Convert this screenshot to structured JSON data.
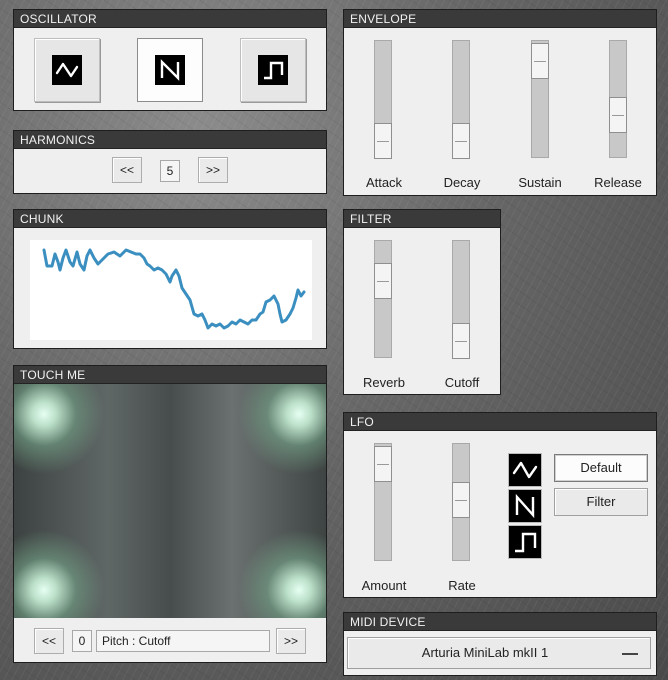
{
  "oscillator": {
    "title": "OSCILLATOR",
    "waveforms": [
      "sine-wave-icon",
      "sawtooth-wave-icon",
      "square-wave-icon"
    ],
    "selected_index": 1
  },
  "harmonics": {
    "title": "HARMONICS",
    "prev_label": "<<",
    "value": "5",
    "next_label": ">>"
  },
  "chunk": {
    "title": "CHUNK",
    "waveform_color": "#3a8fc0"
  },
  "touch": {
    "title": "TOUCH ME",
    "prev_label": "<<",
    "index": "0",
    "mapping": "Pitch :  Cutoff",
    "next_label": ">>",
    "glow_color": "#e6fff2"
  },
  "envelope": {
    "title": "ENVELOPE",
    "sliders": [
      {
        "label": "Attack",
        "value": 0.15
      },
      {
        "label": "Decay",
        "value": 0.15
      },
      {
        "label": "Sustain",
        "value": 0.85
      },
      {
        "label": "Release",
        "value": 0.35
      }
    ]
  },
  "filter": {
    "title": "FILTER",
    "sliders": [
      {
        "label": "Reverb",
        "value": 0.65
      },
      {
        "label": "Cutoff",
        "value": 0.15
      }
    ]
  },
  "lfo": {
    "title": "LFO",
    "sliders": [
      {
        "label": "Amount",
        "value": 0.85
      },
      {
        "label": "Rate",
        "value": 0.55
      }
    ],
    "waveforms": [
      "sine-wave-icon",
      "sawtooth-wave-icon",
      "square-wave-icon"
    ],
    "target_buttons": [
      "Default",
      "Filter"
    ],
    "selected_target": "Default"
  },
  "midi": {
    "title": "MIDI DEVICE",
    "selected_device": "Arturia MiniLab mkII 1"
  }
}
